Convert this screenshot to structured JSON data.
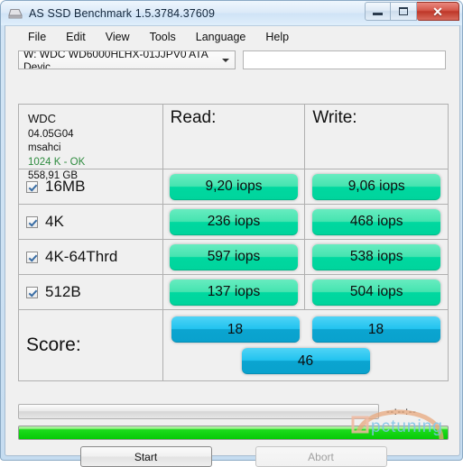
{
  "window": {
    "title": "AS SSD Benchmark 1.5.3784.37609",
    "icon": "hdd-icon",
    "minimize_label": "–",
    "maximize_label": "",
    "close_label": "✕"
  },
  "menu": {
    "items": [
      {
        "label": "File"
      },
      {
        "label": "Edit"
      },
      {
        "label": "View"
      },
      {
        "label": "Tools"
      },
      {
        "label": "Language"
      },
      {
        "label": "Help"
      }
    ]
  },
  "toolbar": {
    "drive_select": "W: WDC WD6000HLHX-01JJPV0 ATA Devic",
    "info_field_value": "",
    "info_field_placeholder": ""
  },
  "drive_info": {
    "model": "WDC",
    "firmware": "04.05G04",
    "driver": "msahci",
    "alignment": "1024 K - OK",
    "capacity": "558,91 GB",
    "alignment_color": "#2e8b3f"
  },
  "table": {
    "read_header": "Read:",
    "write_header": "Write:",
    "rows": [
      {
        "label": "16MB",
        "checked": true,
        "read": "9,20 iops",
        "write": "9,06 iops"
      },
      {
        "label": "4K",
        "checked": true,
        "read": "236 iops",
        "write": "468 iops"
      },
      {
        "label": "4K-64Thrd",
        "checked": true,
        "read": "597 iops",
        "write": "538 iops"
      },
      {
        "label": "512B",
        "checked": true,
        "read": "137 iops",
        "write": "504 iops"
      }
    ],
    "score": {
      "label": "Score:",
      "read": "18",
      "write": "18",
      "total": "46"
    }
  },
  "status": {
    "elapsed_time": "--:--:--",
    "progress_percent": 100
  },
  "buttons": {
    "start": "Start",
    "abort": "Abort"
  },
  "watermark": {
    "text": "pctuning"
  },
  "colors": {
    "bar_green_top": "#67ecc0",
    "bar_green_bottom": "#00d49c",
    "bar_blue_top": "#4fd4f6",
    "bar_blue_bottom": "#09a2cd",
    "progress_green": "#06c906",
    "accent_ok": "#2e8b3f"
  }
}
